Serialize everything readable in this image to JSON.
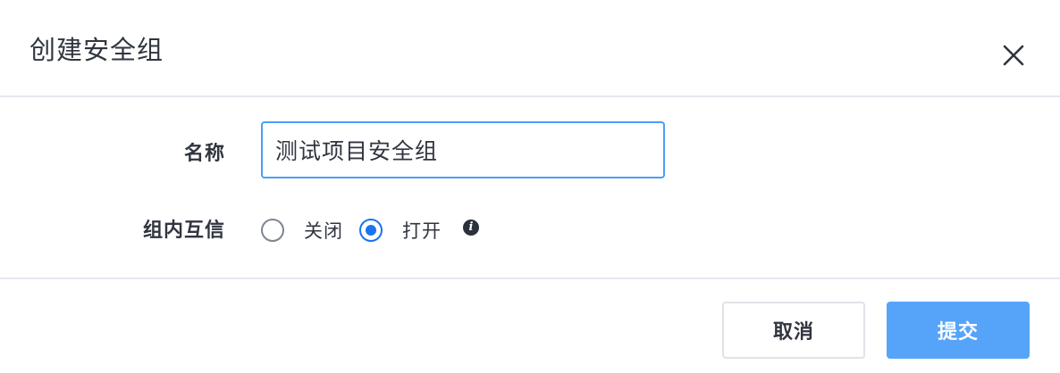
{
  "dialog": {
    "title": "创建安全组"
  },
  "form": {
    "name_label": "名称",
    "name_value": "测试项目安全组",
    "trust_label": "组内互信",
    "trust_options": [
      {
        "label": "关闭",
        "checked": false
      },
      {
        "label": "打开",
        "checked": true
      }
    ],
    "info_icon": "info-icon"
  },
  "footer": {
    "cancel_label": "取消",
    "submit_label": "提交"
  },
  "colors": {
    "primary": "#1a74f0",
    "submit_bg": "#56a4f9",
    "input_focus_border": "#4a9df8",
    "divider": "#e3e8ee"
  }
}
